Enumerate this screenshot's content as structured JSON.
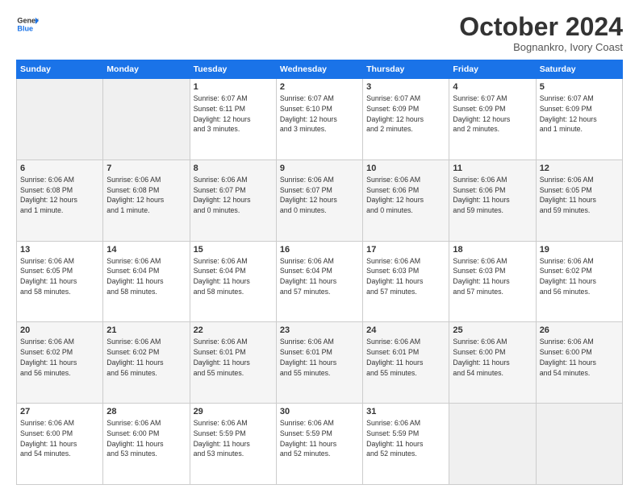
{
  "logo": {
    "line1": "General",
    "line2": "Blue"
  },
  "title": "October 2024",
  "subtitle": "Bognankro, Ivory Coast",
  "weekdays": [
    "Sunday",
    "Monday",
    "Tuesday",
    "Wednesday",
    "Thursday",
    "Friday",
    "Saturday"
  ],
  "weeks": [
    [
      {
        "day": "",
        "info": ""
      },
      {
        "day": "",
        "info": ""
      },
      {
        "day": "1",
        "info": "Sunrise: 6:07 AM\nSunset: 6:11 PM\nDaylight: 12 hours\nand 3 minutes."
      },
      {
        "day": "2",
        "info": "Sunrise: 6:07 AM\nSunset: 6:10 PM\nDaylight: 12 hours\nand 3 minutes."
      },
      {
        "day": "3",
        "info": "Sunrise: 6:07 AM\nSunset: 6:09 PM\nDaylight: 12 hours\nand 2 minutes."
      },
      {
        "day": "4",
        "info": "Sunrise: 6:07 AM\nSunset: 6:09 PM\nDaylight: 12 hours\nand 2 minutes."
      },
      {
        "day": "5",
        "info": "Sunrise: 6:07 AM\nSunset: 6:09 PM\nDaylight: 12 hours\nand 1 minute."
      }
    ],
    [
      {
        "day": "6",
        "info": "Sunrise: 6:06 AM\nSunset: 6:08 PM\nDaylight: 12 hours\nand 1 minute."
      },
      {
        "day": "7",
        "info": "Sunrise: 6:06 AM\nSunset: 6:08 PM\nDaylight: 12 hours\nand 1 minute."
      },
      {
        "day": "8",
        "info": "Sunrise: 6:06 AM\nSunset: 6:07 PM\nDaylight: 12 hours\nand 0 minutes."
      },
      {
        "day": "9",
        "info": "Sunrise: 6:06 AM\nSunset: 6:07 PM\nDaylight: 12 hours\nand 0 minutes."
      },
      {
        "day": "10",
        "info": "Sunrise: 6:06 AM\nSunset: 6:06 PM\nDaylight: 12 hours\nand 0 minutes."
      },
      {
        "day": "11",
        "info": "Sunrise: 6:06 AM\nSunset: 6:06 PM\nDaylight: 11 hours\nand 59 minutes."
      },
      {
        "day": "12",
        "info": "Sunrise: 6:06 AM\nSunset: 6:05 PM\nDaylight: 11 hours\nand 59 minutes."
      }
    ],
    [
      {
        "day": "13",
        "info": "Sunrise: 6:06 AM\nSunset: 6:05 PM\nDaylight: 11 hours\nand 58 minutes."
      },
      {
        "day": "14",
        "info": "Sunrise: 6:06 AM\nSunset: 6:04 PM\nDaylight: 11 hours\nand 58 minutes."
      },
      {
        "day": "15",
        "info": "Sunrise: 6:06 AM\nSunset: 6:04 PM\nDaylight: 11 hours\nand 58 minutes."
      },
      {
        "day": "16",
        "info": "Sunrise: 6:06 AM\nSunset: 6:04 PM\nDaylight: 11 hours\nand 57 minutes."
      },
      {
        "day": "17",
        "info": "Sunrise: 6:06 AM\nSunset: 6:03 PM\nDaylight: 11 hours\nand 57 minutes."
      },
      {
        "day": "18",
        "info": "Sunrise: 6:06 AM\nSunset: 6:03 PM\nDaylight: 11 hours\nand 57 minutes."
      },
      {
        "day": "19",
        "info": "Sunrise: 6:06 AM\nSunset: 6:02 PM\nDaylight: 11 hours\nand 56 minutes."
      }
    ],
    [
      {
        "day": "20",
        "info": "Sunrise: 6:06 AM\nSunset: 6:02 PM\nDaylight: 11 hours\nand 56 minutes."
      },
      {
        "day": "21",
        "info": "Sunrise: 6:06 AM\nSunset: 6:02 PM\nDaylight: 11 hours\nand 56 minutes."
      },
      {
        "day": "22",
        "info": "Sunrise: 6:06 AM\nSunset: 6:01 PM\nDaylight: 11 hours\nand 55 minutes."
      },
      {
        "day": "23",
        "info": "Sunrise: 6:06 AM\nSunset: 6:01 PM\nDaylight: 11 hours\nand 55 minutes."
      },
      {
        "day": "24",
        "info": "Sunrise: 6:06 AM\nSunset: 6:01 PM\nDaylight: 11 hours\nand 55 minutes."
      },
      {
        "day": "25",
        "info": "Sunrise: 6:06 AM\nSunset: 6:00 PM\nDaylight: 11 hours\nand 54 minutes."
      },
      {
        "day": "26",
        "info": "Sunrise: 6:06 AM\nSunset: 6:00 PM\nDaylight: 11 hours\nand 54 minutes."
      }
    ],
    [
      {
        "day": "27",
        "info": "Sunrise: 6:06 AM\nSunset: 6:00 PM\nDaylight: 11 hours\nand 54 minutes."
      },
      {
        "day": "28",
        "info": "Sunrise: 6:06 AM\nSunset: 6:00 PM\nDaylight: 11 hours\nand 53 minutes."
      },
      {
        "day": "29",
        "info": "Sunrise: 6:06 AM\nSunset: 5:59 PM\nDaylight: 11 hours\nand 53 minutes."
      },
      {
        "day": "30",
        "info": "Sunrise: 6:06 AM\nSunset: 5:59 PM\nDaylight: 11 hours\nand 52 minutes."
      },
      {
        "day": "31",
        "info": "Sunrise: 6:06 AM\nSunset: 5:59 PM\nDaylight: 11 hours\nand 52 minutes."
      },
      {
        "day": "",
        "info": ""
      },
      {
        "day": "",
        "info": ""
      }
    ]
  ]
}
